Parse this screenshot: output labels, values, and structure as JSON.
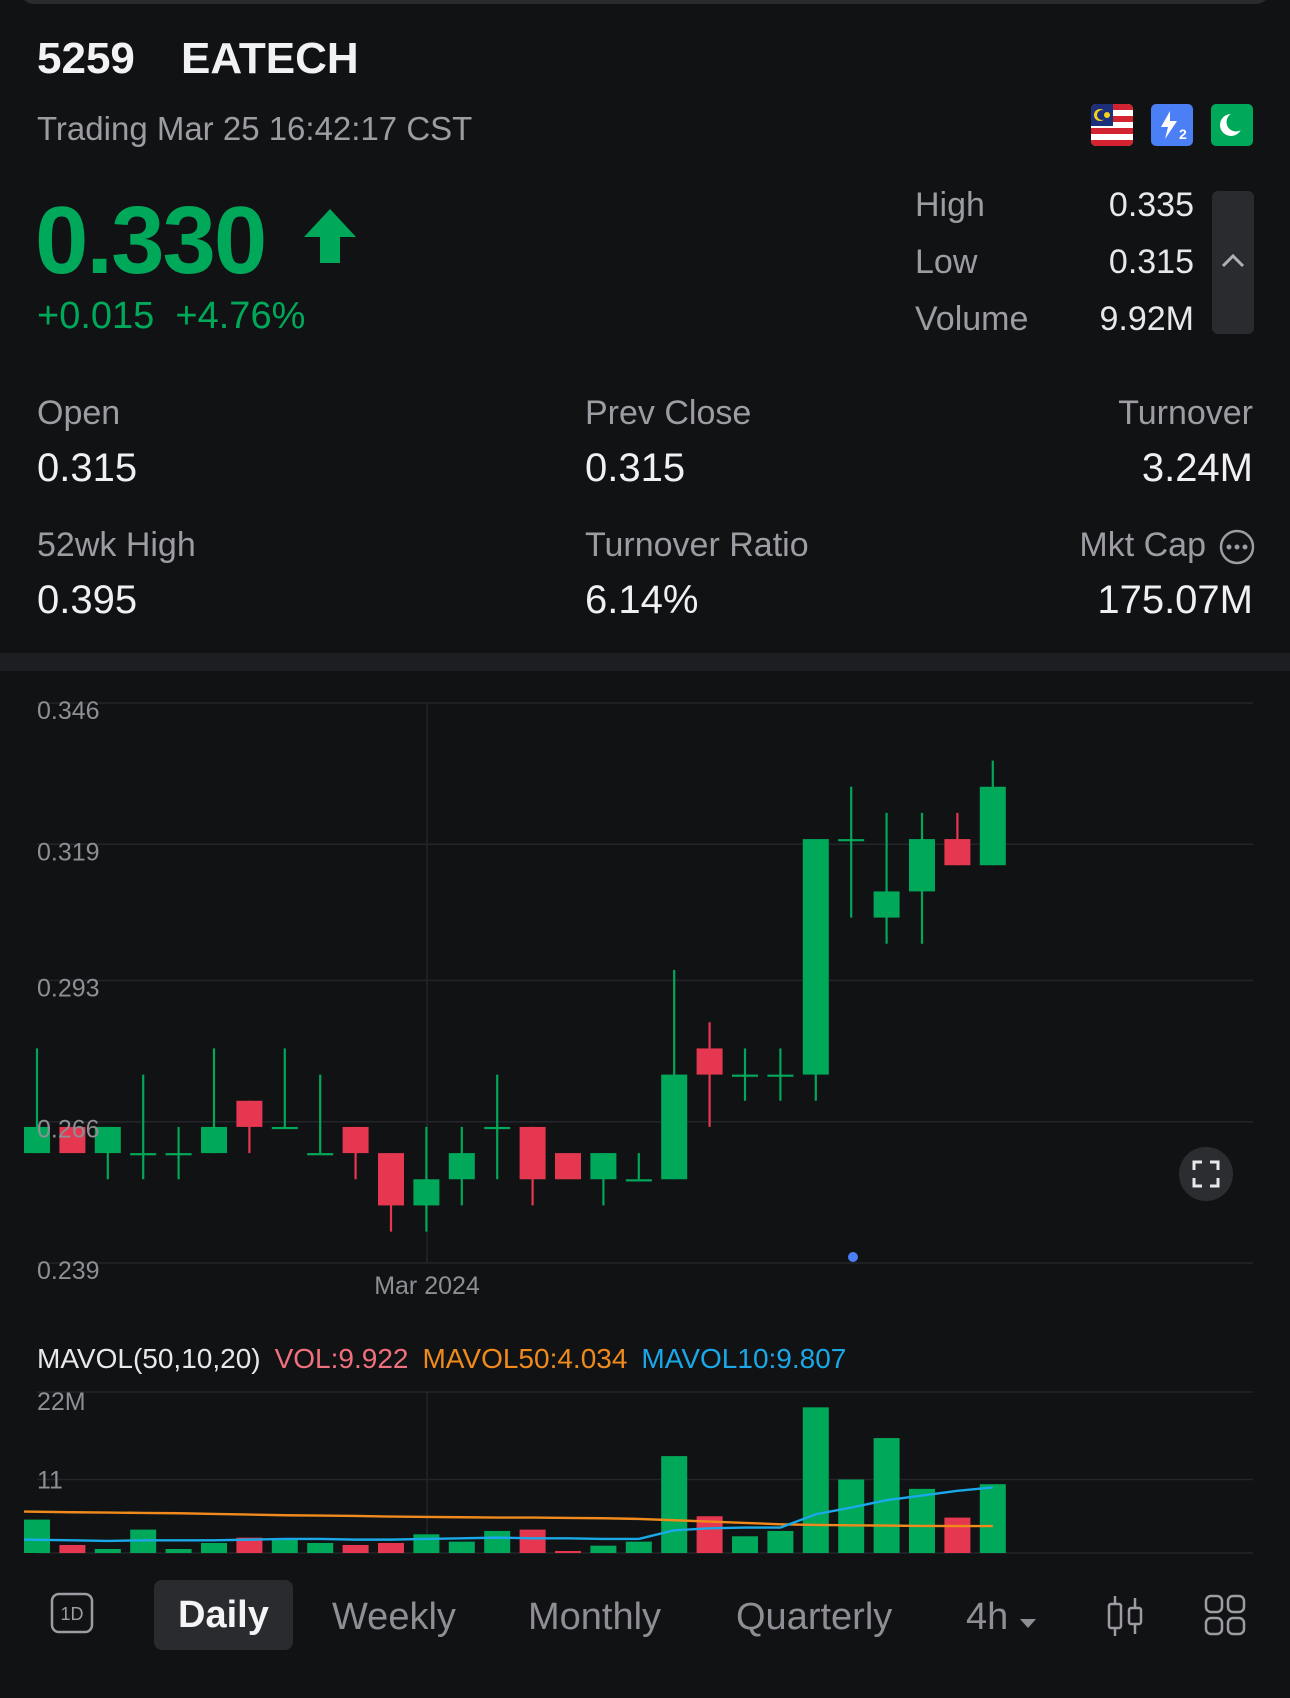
{
  "header": {
    "code": "5259",
    "name": "EATECH",
    "status": "Trading Mar 25 16:42:17 CST",
    "badges": [
      {
        "icon": "malaysia-flag-icon"
      },
      {
        "icon": "lightning-level2-icon",
        "color": "#4a7ff5",
        "text": "2"
      },
      {
        "icon": "moon-icon",
        "color": "#00a85a"
      }
    ]
  },
  "quote": {
    "price": "0.330",
    "change": "+0.015",
    "change_pct": "+4.76%",
    "color_up": "#00a85a",
    "color_down": "#e5374f",
    "high_label": "High",
    "high": "0.335",
    "low_label": "Low",
    "low": "0.315",
    "volume_label": "Volume",
    "volume": "9.92M"
  },
  "stats": [
    {
      "label": "Open",
      "value": "0.315"
    },
    {
      "label": "Prev Close",
      "value": "0.315"
    },
    {
      "label": "Turnover",
      "value": "3.24M"
    },
    {
      "label": "52wk High",
      "value": "0.395"
    },
    {
      "label": "Turnover Ratio",
      "value": "6.14%"
    },
    {
      "label": "Mkt Cap",
      "value": "175.07M"
    }
  ],
  "chart_data": [
    {
      "type": "candlestick",
      "y_ticks": [
        "0.346",
        "0.319",
        "0.293",
        "0.266",
        "0.239"
      ],
      "ylim": [
        0.239,
        0.346
      ],
      "x_tick": "Mar 2024",
      "grid": true,
      "candles": [
        {
          "o": 0.26,
          "c": 0.265,
          "h": 0.28,
          "l": 0.26
        },
        {
          "o": 0.265,
          "c": 0.26,
          "h": 0.265,
          "l": 0.26
        },
        {
          "o": 0.26,
          "c": 0.265,
          "h": 0.265,
          "l": 0.255
        },
        {
          "o": 0.26,
          "c": 0.26,
          "h": 0.275,
          "l": 0.255
        },
        {
          "o": 0.26,
          "c": 0.26,
          "h": 0.265,
          "l": 0.255
        },
        {
          "o": 0.26,
          "c": 0.265,
          "h": 0.28,
          "l": 0.26
        },
        {
          "o": 0.27,
          "c": 0.265,
          "h": 0.27,
          "l": 0.26
        },
        {
          "o": 0.265,
          "c": 0.265,
          "h": 0.28,
          "l": 0.265
        },
        {
          "o": 0.26,
          "c": 0.26,
          "h": 0.275,
          "l": 0.26
        },
        {
          "o": 0.265,
          "c": 0.26,
          "h": 0.265,
          "l": 0.255
        },
        {
          "o": 0.26,
          "c": 0.25,
          "h": 0.26,
          "l": 0.245
        },
        {
          "o": 0.25,
          "c": 0.255,
          "h": 0.265,
          "l": 0.245
        },
        {
          "o": 0.255,
          "c": 0.26,
          "h": 0.265,
          "l": 0.25
        },
        {
          "o": 0.265,
          "c": 0.265,
          "h": 0.275,
          "l": 0.255
        },
        {
          "o": 0.265,
          "c": 0.255,
          "h": 0.265,
          "l": 0.25
        },
        {
          "o": 0.26,
          "c": 0.255,
          "h": 0.26,
          "l": 0.255
        },
        {
          "o": 0.255,
          "c": 0.26,
          "h": 0.26,
          "l": 0.25
        },
        {
          "o": 0.255,
          "c": 0.255,
          "h": 0.26,
          "l": 0.255
        },
        {
          "o": 0.255,
          "c": 0.275,
          "h": 0.295,
          "l": 0.255
        },
        {
          "o": 0.28,
          "c": 0.275,
          "h": 0.285,
          "l": 0.265
        },
        {
          "o": 0.275,
          "c": 0.275,
          "h": 0.28,
          "l": 0.27
        },
        {
          "o": 0.275,
          "c": 0.275,
          "h": 0.28,
          "l": 0.27
        },
        {
          "o": 0.275,
          "c": 0.32,
          "h": 0.32,
          "l": 0.27
        },
        {
          "o": 0.32,
          "c": 0.32,
          "h": 0.33,
          "l": 0.305
        },
        {
          "o": 0.305,
          "c": 0.31,
          "h": 0.325,
          "l": 0.3
        },
        {
          "o": 0.31,
          "c": 0.32,
          "h": 0.325,
          "l": 0.3
        },
        {
          "o": 0.32,
          "c": 0.315,
          "h": 0.325,
          "l": 0.315
        },
        {
          "o": 0.315,
          "c": 0.33,
          "h": 0.335,
          "l": 0.315
        }
      ]
    },
    {
      "type": "bar",
      "title": "MAVOL(50,10,20)",
      "labels": [
        {
          "text": "VOL:9.922",
          "color": "#f0707e"
        },
        {
          "text": "MAVOL50:4.034",
          "color": "#f08a1c"
        },
        {
          "text": "MAVOL10:9.807",
          "color": "#1aa8e8"
        }
      ],
      "y_ticks": [
        "22M",
        "11"
      ],
      "ylim": [
        0,
        22
      ],
      "volumes": [
        5.0,
        1.2,
        0.6,
        3.5,
        0.6,
        1.5,
        2.3,
        2.0,
        1.5,
        1.2,
        1.5,
        2.8,
        1.7,
        3.3,
        3.5,
        0.3,
        1.1,
        1.7,
        14.5,
        5.5,
        2.5,
        3.3,
        21.8,
        11.0,
        17.2,
        9.6,
        5.3,
        10.3
      ],
      "mavol50": [
        6.2,
        6.1,
        6.05,
        6.0,
        5.95,
        5.85,
        5.75,
        5.65,
        5.6,
        5.55,
        5.45,
        5.4,
        5.35,
        5.3,
        5.3,
        5.25,
        5.2,
        5.1,
        4.9,
        4.7,
        4.5,
        4.3,
        4.2,
        4.15,
        4.1,
        4.05,
        4.03,
        4.034
      ],
      "mavol10": [
        2.0,
        1.9,
        1.8,
        1.9,
        1.9,
        1.9,
        2.0,
        2.1,
        2.1,
        2.0,
        2.0,
        2.1,
        2.2,
        2.3,
        2.2,
        2.2,
        2.1,
        2.1,
        3.4,
        3.7,
        3.8,
        3.8,
        5.8,
        6.8,
        7.9,
        8.6,
        9.3,
        9.807
      ],
      "colors": {
        "up": "#00a85a",
        "down": "#e5374f",
        "ma50": "#f08a1c",
        "ma10": "#1aa8e8"
      }
    }
  ],
  "tabs": [
    {
      "label": "Daily",
      "active": true
    },
    {
      "label": "Weekly"
    },
    {
      "label": "Monthly"
    },
    {
      "label": "Quarterly"
    },
    {
      "label": "4h"
    }
  ],
  "intraday_label": "1D"
}
